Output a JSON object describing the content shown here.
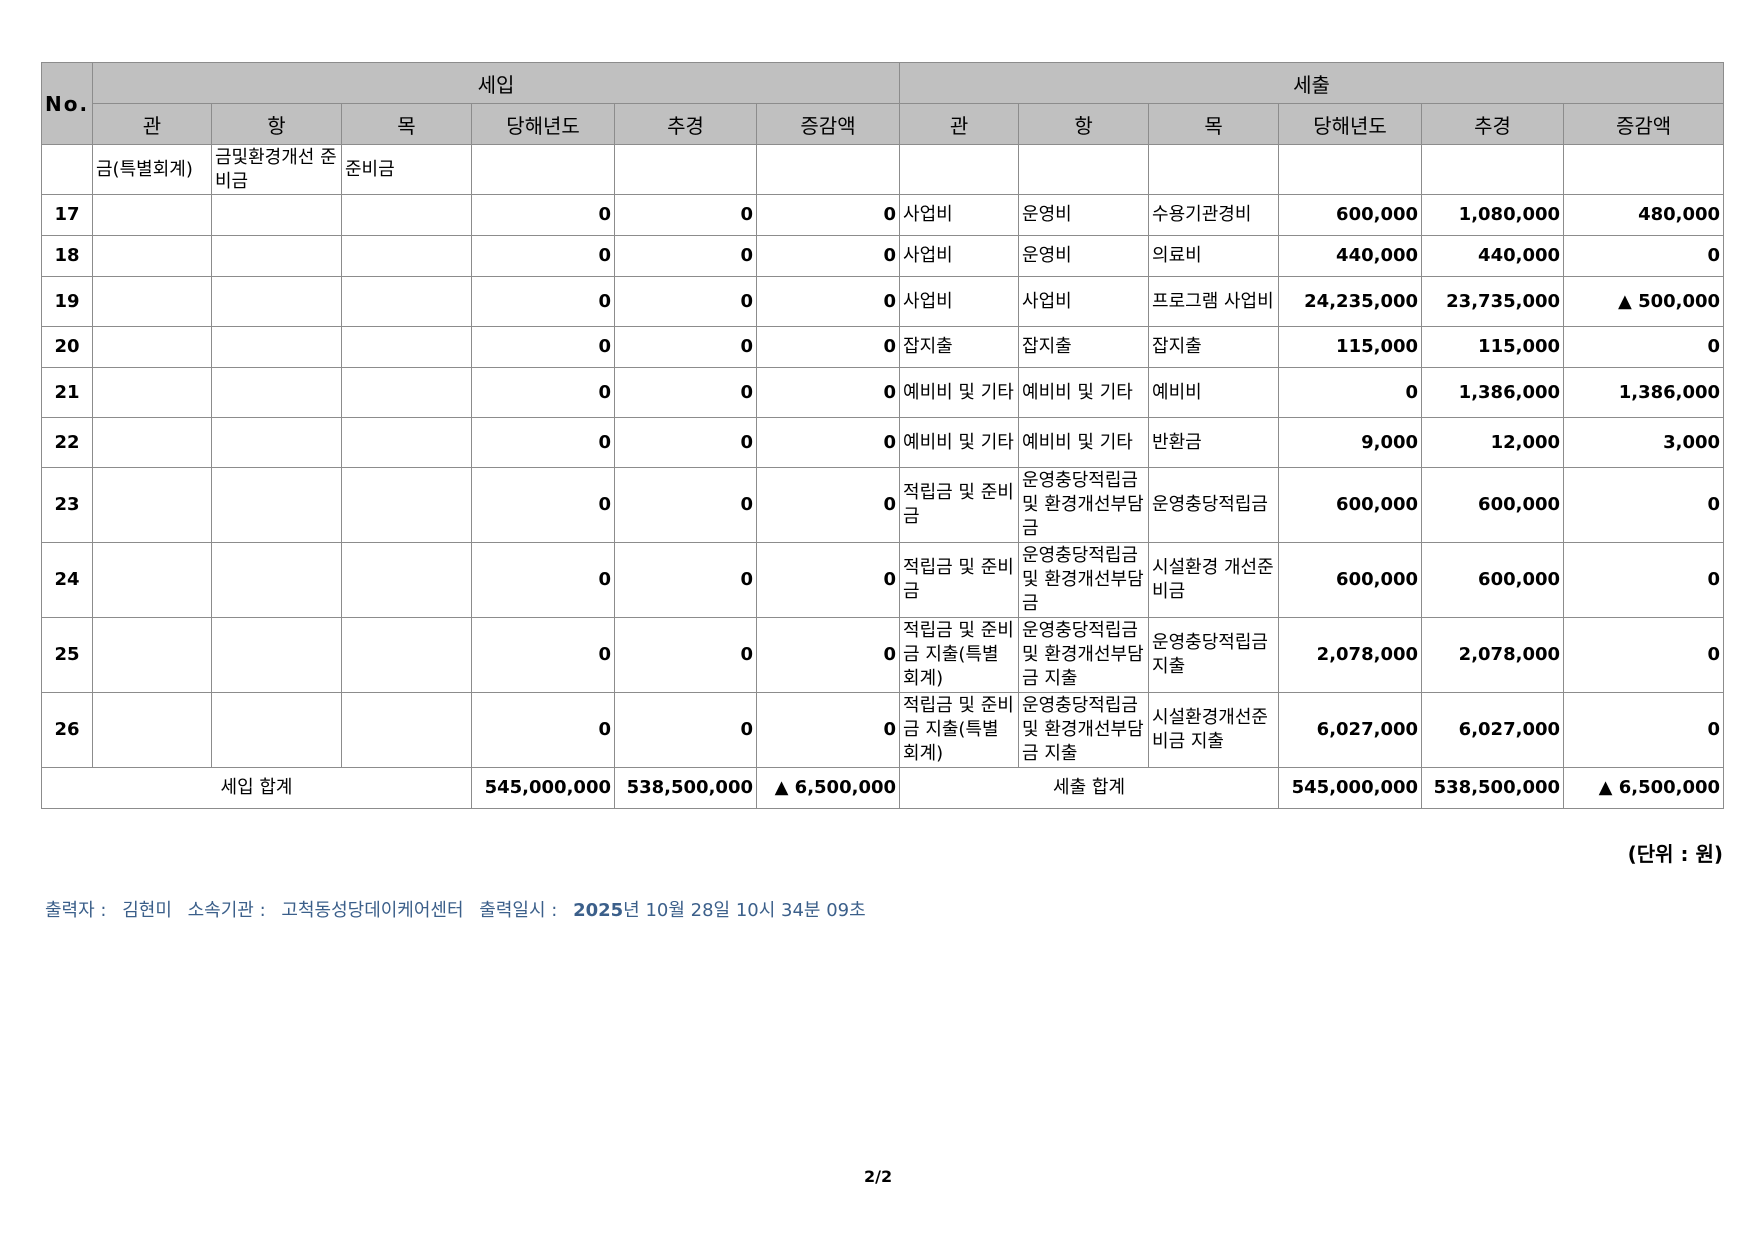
{
  "headers": {
    "no": "No.",
    "income": "세입",
    "expense": "세출",
    "sub": [
      "관",
      "항",
      "목",
      "당해년도",
      "추경",
      "증감액"
    ]
  },
  "cont_row": {
    "gwan": "금(특별회계)",
    "hang": "금및환경개선 준비금",
    "mok": "준비금"
  },
  "rows": [
    {
      "no": "17",
      "in_cur": "0",
      "in_sup": "0",
      "in_diff": "0",
      "gwan": "사업비",
      "hang": "운영비",
      "mok": "수용기관경비",
      "ex_cur": "600,000",
      "ex_sup": "1,080,000",
      "ex_diff": "480,000"
    },
    {
      "no": "18",
      "in_cur": "0",
      "in_sup": "0",
      "in_diff": "0",
      "gwan": "사업비",
      "hang": "운영비",
      "mok": "의료비",
      "ex_cur": "440,000",
      "ex_sup": "440,000",
      "ex_diff": "0"
    },
    {
      "no": "19",
      "in_cur": "0",
      "in_sup": "0",
      "in_diff": "0",
      "gwan": "사업비",
      "hang": "사업비",
      "mok": "프로그램 사업비",
      "ex_cur": "24,235,000",
      "ex_sup": "23,735,000",
      "ex_diff": "▲ 500,000"
    },
    {
      "no": "20",
      "in_cur": "0",
      "in_sup": "0",
      "in_diff": "0",
      "gwan": "잡지출",
      "hang": "잡지출",
      "mok": "잡지출",
      "ex_cur": "115,000",
      "ex_sup": "115,000",
      "ex_diff": "0"
    },
    {
      "no": "21",
      "in_cur": "0",
      "in_sup": "0",
      "in_diff": "0",
      "gwan": "예비비 및 기타",
      "hang": "예비비 및 기타",
      "mok": "예비비",
      "ex_cur": "0",
      "ex_sup": "1,386,000",
      "ex_diff": "1,386,000"
    },
    {
      "no": "22",
      "in_cur": "0",
      "in_sup": "0",
      "in_diff": "0",
      "gwan": "예비비 및 기타",
      "hang": "예비비 및 기타",
      "mok": "반환금",
      "ex_cur": "9,000",
      "ex_sup": "12,000",
      "ex_diff": "3,000"
    },
    {
      "no": "23",
      "in_cur": "0",
      "in_sup": "0",
      "in_diff": "0",
      "gwan": "적립금 및 준비금",
      "hang": "운영충당적립금 및 환경개선부담금",
      "mok": "운영충당적립금",
      "ex_cur": "600,000",
      "ex_sup": "600,000",
      "ex_diff": "0"
    },
    {
      "no": "24",
      "in_cur": "0",
      "in_sup": "0",
      "in_diff": "0",
      "gwan": "적립금 및 준비금",
      "hang": "운영충당적립금 및 환경개선부담금",
      "mok": "시설환경 개선준비금",
      "ex_cur": "600,000",
      "ex_sup": "600,000",
      "ex_diff": "0"
    },
    {
      "no": "25",
      "in_cur": "0",
      "in_sup": "0",
      "in_diff": "0",
      "gwan": "적립금 및 준비금 지출(특별회계)",
      "hang": "운영충당적립금 및 환경개선부담금 지출",
      "mok": "운영충당적립금 지출",
      "ex_cur": "2,078,000",
      "ex_sup": "2,078,000",
      "ex_diff": "0"
    },
    {
      "no": "26",
      "in_cur": "0",
      "in_sup": "0",
      "in_diff": "0",
      "gwan": "적립금 및 준비금 지출(특별회계)",
      "hang": "운영충당적립금 및 환경개선부담금 지출",
      "mok": "시설환경개선준비금 지출",
      "ex_cur": "6,027,000",
      "ex_sup": "6,027,000",
      "ex_diff": "0"
    }
  ],
  "totals": {
    "in_label": "세입 합계",
    "in_cur": "545,000,000",
    "in_sup": "538,500,000",
    "in_diff": "▲ 6,500,000",
    "ex_label": "세출 합계",
    "ex_cur": "545,000,000",
    "ex_sup": "538,500,000",
    "ex_diff": "▲ 6,500,000"
  },
  "unit": "(단위 : 원)",
  "footer": {
    "printer_label": "출력자 :",
    "printer": "김현미",
    "org_label": "소속기관 :",
    "org": "고척동성당데이케어센터",
    "date_label": "출력일시 :",
    "date_year": "2025",
    "date_rest": "년 10월 28일 10시 34분 09초"
  },
  "page": "2/2"
}
